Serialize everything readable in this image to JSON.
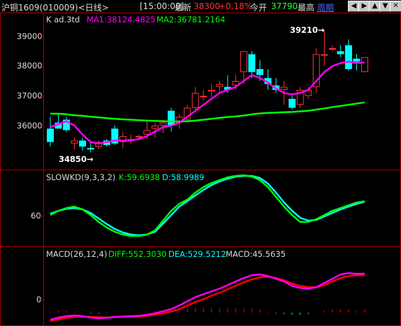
{
  "header": {
    "instrument": "沪铜1609(010009)<日线>",
    "time": "[15:00:00]",
    "last_label": "最新",
    "last_value": "38300",
    "change_pct": "+0.18%",
    "open_label": "今开",
    "open_value": "37790",
    "high_label": "最高",
    "period_link": "周期",
    "nav_buttons": [
      "◀",
      "▶",
      "▲",
      "▼",
      "✕"
    ]
  },
  "colors": {
    "up": "#ff3333",
    "down": "#00ffff",
    "ma1": "#ff00ff",
    "ma2": "#00ff00",
    "pane_border": "#aa0000",
    "axis_text": "#dcdcdc",
    "macd_red": "#ff0000"
  },
  "main_pane": {
    "indicator_label": "K  ad.3td",
    "ma1_label": "MA1:38124.4825",
    "ma2_label": "MA2:36781.2164",
    "high_annotation": "39210→",
    "low_annotation": "34850→",
    "y_ticks": [
      "39000",
      "38000",
      "37000",
      "36000"
    ]
  },
  "kd_pane": {
    "label": "SLOWKD(9,3,3,2)",
    "k_label": "K:59.6938",
    "d_label": "D:58.9989",
    "y_ticks": [
      "60"
    ]
  },
  "macd_pane": {
    "label": "MACD(26,12,4)",
    "diff_label": "DIFF:552.3030",
    "dea_label": "DEA:529.5212",
    "macd_label": "MACD:45.5635",
    "y_ticks": [
      "0"
    ]
  },
  "chart_data": {
    "type": "candlestick",
    "y_range": [
      34500,
      39500
    ],
    "candles": [
      [
        35900,
        36300,
        35300,
        35450
      ],
      [
        36100,
        36400,
        35900,
        35900
      ],
      [
        36200,
        36300,
        35800,
        35850
      ],
      [
        35400,
        35600,
        35200,
        35500
      ],
      [
        35500,
        35600,
        35150,
        35300
      ],
      [
        35250,
        35500,
        35100,
        35200
      ],
      [
        35300,
        35500,
        35200,
        35450
      ],
      [
        35500,
        35550,
        35300,
        35350
      ],
      [
        35900,
        36000,
        35350,
        35400
      ],
      [
        35450,
        35800,
        35250,
        35650
      ],
      [
        35500,
        35700,
        35400,
        35550
      ],
      [
        35600,
        35700,
        35500,
        35650
      ],
      [
        35700,
        36200,
        35550,
        35850
      ],
      [
        35900,
        36100,
        35600,
        36000
      ],
      [
        36000,
        36200,
        35750,
        36100
      ],
      [
        36500,
        36600,
        35800,
        36000
      ],
      [
        36100,
        36400,
        35900,
        36300
      ],
      [
        36200,
        36700,
        36100,
        36600
      ],
      [
        36600,
        37300,
        36500,
        37100
      ],
      [
        37000,
        37200,
        36850,
        37000
      ],
      [
        37150,
        37400,
        36950,
        37200
      ],
      [
        37300,
        37500,
        37100,
        37400
      ],
      [
        37300,
        37700,
        37100,
        37200
      ],
      [
        37350,
        37700,
        37200,
        37500
      ],
      [
        37800,
        38500,
        37400,
        38500
      ],
      [
        38400,
        38500,
        37600,
        37800
      ],
      [
        37900,
        38200,
        37500,
        37700
      ],
      [
        37600,
        37900,
        37200,
        37400
      ],
      [
        37350,
        37600,
        37100,
        37200
      ],
      [
        37200,
        37500,
        36700,
        37300
      ],
      [
        36900,
        37050,
        36550,
        36600
      ],
      [
        36700,
        37300,
        36600,
        37200
      ],
      [
        37000,
        37300,
        36900,
        37200
      ],
      [
        37300,
        38600,
        37100,
        38400
      ],
      [
        38350,
        39210,
        38000,
        38400
      ],
      [
        38600,
        38700,
        38500,
        38600
      ],
      [
        38500,
        38700,
        38300,
        38400
      ],
      [
        38700,
        38900,
        37850,
        37900
      ],
      [
        38250,
        38400,
        37850,
        38150
      ],
      [
        37800,
        38300,
        37790,
        38300
      ]
    ],
    "series": [
      {
        "name": "MA1",
        "values": [
          35950,
          36050,
          36150,
          36000,
          35700,
          35450,
          35400,
          35450,
          35500,
          35500,
          35500,
          35550,
          35650,
          35800,
          35950,
          36000,
          36100,
          36300,
          36500,
          36700,
          36900,
          37100,
          37200,
          37300,
          37500,
          37700,
          37600,
          37450,
          37250,
          37100,
          37050,
          37100,
          37200,
          37500,
          37800,
          38000,
          38100,
          38150,
          38100,
          38124
        ]
      },
      {
        "name": "MA2",
        "values": [
          36400,
          36400,
          36380,
          36350,
          36330,
          36300,
          36280,
          36250,
          36230,
          36210,
          36200,
          36180,
          36170,
          36160,
          36150,
          36140,
          36140,
          36150,
          36170,
          36200,
          36230,
          36260,
          36290,
          36310,
          36340,
          36380,
          36410,
          36430,
          36440,
          36450,
          36460,
          36480,
          36500,
          36540,
          36580,
          36620,
          36660,
          36700,
          36740,
          36781
        ]
      }
    ],
    "kd": {
      "y_range": [
        0,
        100
      ],
      "k": [
        40,
        46,
        50,
        52,
        48,
        40,
        30,
        22,
        16,
        12,
        10,
        10,
        12,
        18,
        32,
        46,
        56,
        62,
        72,
        80,
        86,
        90,
        94,
        96,
        97,
        95,
        90,
        80,
        66,
        52,
        40,
        30,
        30,
        34,
        40,
        46,
        50,
        54,
        58,
        59.7
      ],
      "d": [
        42,
        46,
        49,
        50,
        48,
        43,
        35,
        27,
        20,
        15,
        12,
        11,
        12,
        16,
        28,
        40,
        52,
        60,
        68,
        76,
        83,
        88,
        92,
        95,
        96,
        96,
        93,
        85,
        72,
        58,
        46,
        36,
        32,
        33,
        38,
        43,
        48,
        52,
        56,
        59.0
      ]
    },
    "macd": {
      "y_range": [
        -160,
        750
      ],
      "diff": [
        -100,
        -70,
        -50,
        -40,
        -50,
        -70,
        -80,
        -75,
        -60,
        -55,
        -50,
        -45,
        -30,
        -10,
        20,
        50,
        100,
        160,
        220,
        260,
        300,
        340,
        390,
        440,
        490,
        530,
        540,
        520,
        480,
        440,
        380,
        350,
        340,
        360,
        420,
        480,
        540,
        560,
        550,
        552
      ],
      "dea": [
        -120,
        -95,
        -75,
        -60,
        -55,
        -60,
        -65,
        -68,
        -64,
        -60,
        -56,
        -52,
        -44,
        -30,
        -10,
        15,
        50,
        100,
        150,
        190,
        240,
        280,
        330,
        380,
        430,
        470,
        500,
        510,
        490,
        460,
        410,
        380,
        360,
        360,
        390,
        440,
        490,
        520,
        530,
        529.5
      ],
      "hist": [
        20,
        25,
        25,
        20,
        5,
        -10,
        -15,
        -7,
        4,
        5,
        6,
        7,
        14,
        20,
        30,
        35,
        50,
        60,
        70,
        70,
        60,
        60,
        60,
        60,
        60,
        60,
        40,
        10,
        -10,
        -20,
        -30,
        -30,
        -20,
        0,
        30,
        40,
        50,
        40,
        20,
        45.6
      ]
    }
  }
}
